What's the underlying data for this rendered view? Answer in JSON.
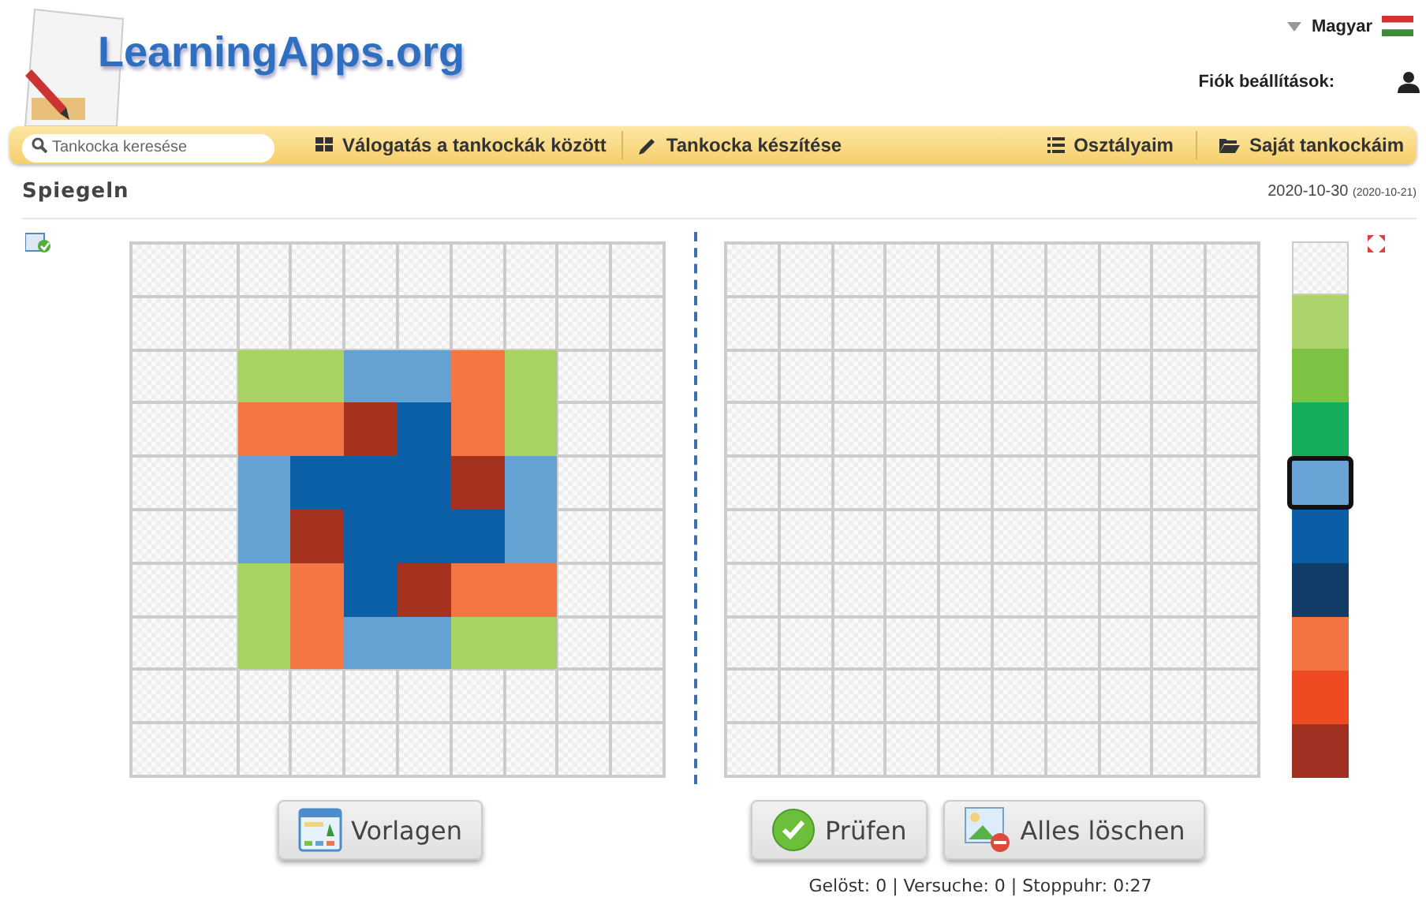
{
  "header": {
    "logo": "LearningApps.org",
    "language": "Magyar",
    "account": "Fiók beállítások:"
  },
  "nav": {
    "search": {
      "placeholder": "Tankocka keresése"
    },
    "items": [
      "Válogatás a tankockák között",
      "Tankocka készítése",
      "Osztályaim",
      "Saját tankockáim"
    ]
  },
  "page": {
    "title": "Spiegeln",
    "date": "2020-10-30",
    "date_original": "(2020-10-21)"
  },
  "template_grid": [
    [
      {
        "filled": false
      },
      {
        "filled": false
      },
      {
        "filled": false
      },
      {
        "filled": false
      },
      {
        "filled": false
      },
      {
        "filled": false
      },
      {
        "filled": false
      },
      {
        "filled": false
      },
      {
        "filled": false
      },
      {
        "filled": false
      }
    ],
    [
      {
        "filled": false
      },
      {
        "filled": false
      },
      {
        "filled": false
      },
      {
        "filled": false
      },
      {
        "filled": false
      },
      {
        "filled": false
      },
      {
        "filled": false
      },
      {
        "filled": false
      },
      {
        "filled": false
      },
      {
        "filled": false
      }
    ],
    [
      {
        "filled": false
      },
      {
        "filled": false
      },
      {
        "filled": true,
        "color": "#a9d264"
      },
      {
        "filled": true,
        "color": "#a9d264"
      },
      {
        "filled": true,
        "color": "#64a2d4"
      },
      {
        "filled": true,
        "color": "#64a2d4"
      },
      {
        "filled": true,
        "color": "#f47644"
      },
      {
        "filled": true,
        "color": "#a9d264"
      },
      {
        "filled": false
      },
      {
        "filled": false
      }
    ],
    [
      {
        "filled": false
      },
      {
        "filled": false
      },
      {
        "filled": true,
        "color": "#f47644"
      },
      {
        "filled": true,
        "color": "#f47644"
      },
      {
        "filled": true,
        "color": "#a5311f"
      },
      {
        "filled": true,
        "color": "#0a5fa6"
      },
      {
        "filled": true,
        "color": "#f47644"
      },
      {
        "filled": true,
        "color": "#a9d264"
      },
      {
        "filled": false
      },
      {
        "filled": false
      }
    ],
    [
      {
        "filled": false
      },
      {
        "filled": false
      },
      {
        "filled": true,
        "color": "#64a2d4"
      },
      {
        "filled": true,
        "color": "#0a5fa6"
      },
      {
        "filled": true,
        "color": "#0a5fa6"
      },
      {
        "filled": true,
        "color": "#0a5fa6"
      },
      {
        "filled": true,
        "color": "#a5311f"
      },
      {
        "filled": true,
        "color": "#64a2d4"
      },
      {
        "filled": false
      },
      {
        "filled": false
      }
    ],
    [
      {
        "filled": false
      },
      {
        "filled": false
      },
      {
        "filled": true,
        "color": "#64a2d4"
      },
      {
        "filled": true,
        "color": "#a5311f"
      },
      {
        "filled": true,
        "color": "#0a5fa6"
      },
      {
        "filled": true,
        "color": "#0a5fa6"
      },
      {
        "filled": true,
        "color": "#0a5fa6"
      },
      {
        "filled": true,
        "color": "#64a2d4"
      },
      {
        "filled": false
      },
      {
        "filled": false
      }
    ],
    [
      {
        "filled": false
      },
      {
        "filled": false
      },
      {
        "filled": true,
        "color": "#a9d264"
      },
      {
        "filled": true,
        "color": "#f47644"
      },
      {
        "filled": true,
        "color": "#0a5fa6"
      },
      {
        "filled": true,
        "color": "#a5311f"
      },
      {
        "filled": true,
        "color": "#f47644"
      },
      {
        "filled": true,
        "color": "#f47644"
      },
      {
        "filled": false
      },
      {
        "filled": false
      }
    ],
    [
      {
        "filled": false
      },
      {
        "filled": false
      },
      {
        "filled": true,
        "color": "#a9d264"
      },
      {
        "filled": true,
        "color": "#f47644"
      },
      {
        "filled": true,
        "color": "#64a2d4"
      },
      {
        "filled": true,
        "color": "#64a2d4"
      },
      {
        "filled": true,
        "color": "#a9d264"
      },
      {
        "filled": true,
        "color": "#a9d264"
      },
      {
        "filled": false
      },
      {
        "filled": false
      }
    ],
    [
      {
        "filled": false
      },
      {
        "filled": false
      },
      {
        "filled": false
      },
      {
        "filled": false
      },
      {
        "filled": false
      },
      {
        "filled": false
      },
      {
        "filled": false
      },
      {
        "filled": false
      },
      {
        "filled": false
      },
      {
        "filled": false
      }
    ],
    [
      {
        "filled": false
      },
      {
        "filled": false
      },
      {
        "filled": false
      },
      {
        "filled": false
      },
      {
        "filled": false
      },
      {
        "filled": false
      },
      {
        "filled": false
      },
      {
        "filled": false
      },
      {
        "filled": false
      },
      {
        "filled": false
      }
    ]
  ],
  "answer_grid": [
    [
      {
        "filled": false
      },
      {
        "filled": false
      },
      {
        "filled": false
      },
      {
        "filled": false
      },
      {
        "filled": false
      },
      {
        "filled": false
      },
      {
        "filled": false
      },
      {
        "filled": false
      },
      {
        "filled": false
      },
      {
        "filled": false
      }
    ],
    [
      {
        "filled": false
      },
      {
        "filled": false
      },
      {
        "filled": false
      },
      {
        "filled": false
      },
      {
        "filled": false
      },
      {
        "filled": false
      },
      {
        "filled": false
      },
      {
        "filled": false
      },
      {
        "filled": false
      },
      {
        "filled": false
      }
    ],
    [
      {
        "filled": false
      },
      {
        "filled": false
      },
      {
        "filled": false
      },
      {
        "filled": false
      },
      {
        "filled": false
      },
      {
        "filled": false
      },
      {
        "filled": false
      },
      {
        "filled": false
      },
      {
        "filled": false
      },
      {
        "filled": false
      }
    ],
    [
      {
        "filled": false
      },
      {
        "filled": false
      },
      {
        "filled": false
      },
      {
        "filled": false
      },
      {
        "filled": false
      },
      {
        "filled": false
      },
      {
        "filled": false
      },
      {
        "filled": false
      },
      {
        "filled": false
      },
      {
        "filled": false
      }
    ],
    [
      {
        "filled": false
      },
      {
        "filled": false
      },
      {
        "filled": false
      },
      {
        "filled": false
      },
      {
        "filled": false
      },
      {
        "filled": false
      },
      {
        "filled": false
      },
      {
        "filled": false
      },
      {
        "filled": false
      },
      {
        "filled": false
      }
    ],
    [
      {
        "filled": false
      },
      {
        "filled": false
      },
      {
        "filled": false
      },
      {
        "filled": false
      },
      {
        "filled": false
      },
      {
        "filled": false
      },
      {
        "filled": false
      },
      {
        "filled": false
      },
      {
        "filled": false
      },
      {
        "filled": false
      }
    ],
    [
      {
        "filled": false
      },
      {
        "filled": false
      },
      {
        "filled": false
      },
      {
        "filled": false
      },
      {
        "filled": false
      },
      {
        "filled": false
      },
      {
        "filled": false
      },
      {
        "filled": false
      },
      {
        "filled": false
      },
      {
        "filled": false
      }
    ],
    [
      {
        "filled": false
      },
      {
        "filled": false
      },
      {
        "filled": false
      },
      {
        "filled": false
      },
      {
        "filled": false
      },
      {
        "filled": false
      },
      {
        "filled": false
      },
      {
        "filled": false
      },
      {
        "filled": false
      },
      {
        "filled": false
      }
    ],
    [
      {
        "filled": false
      },
      {
        "filled": false
      },
      {
        "filled": false
      },
      {
        "filled": false
      },
      {
        "filled": false
      },
      {
        "filled": false
      },
      {
        "filled": false
      },
      {
        "filled": false
      },
      {
        "filled": false
      },
      {
        "filled": false
      }
    ],
    [
      {
        "filled": false
      },
      {
        "filled": false
      },
      {
        "filled": false
      },
      {
        "filled": false
      },
      {
        "filled": false
      },
      {
        "filled": false
      },
      {
        "filled": false
      },
      {
        "filled": false
      },
      {
        "filled": false
      },
      {
        "filled": false
      }
    ]
  ],
  "palette": [
    {
      "kind": "empty",
      "selected": false
    },
    {
      "kind": "color",
      "color": "#add46c",
      "selected": false
    },
    {
      "kind": "color",
      "color": "#7cc243",
      "selected": false
    },
    {
      "kind": "color",
      "color": "#15ae5c",
      "selected": false
    },
    {
      "kind": "color",
      "color": "#6aa4d6",
      "selected": true
    },
    {
      "kind": "color",
      "color": "#0b5ea6",
      "selected": false
    },
    {
      "kind": "color",
      "color": "#113d68",
      "selected": false
    },
    {
      "kind": "color",
      "color": "#f37343",
      "selected": false
    },
    {
      "kind": "color",
      "color": "#ef4b23",
      "selected": false
    },
    {
      "kind": "color",
      "color": "#a12f22",
      "selected": false
    }
  ],
  "buttons": {
    "templates": "Vorlagen",
    "check": "Prüfen",
    "clear": "Alles löschen"
  },
  "status": "Gelöst: 0 | Versuche: 0 | Stoppuhr: 0:27"
}
